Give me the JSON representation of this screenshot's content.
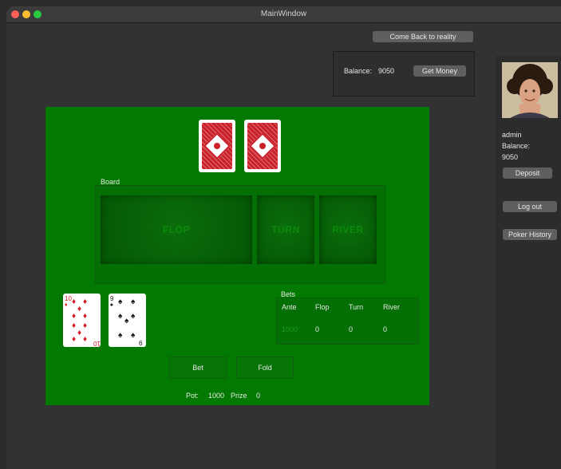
{
  "window": {
    "title": "MainWindow"
  },
  "header": {
    "back_button": "Come Back to reality"
  },
  "balance_box": {
    "label": "Balance:",
    "value": "9050",
    "get_money_button": "Get Money"
  },
  "sidebar": {
    "username": "admin",
    "balance_label": "Balance:",
    "balance_value": "9050",
    "deposit_button": "Deposit",
    "logout_button": "Log out",
    "history_button": "Poker History"
  },
  "table": {
    "board_title": "Board",
    "flop_label": "FLOP",
    "turn_label": "TURN",
    "river_label": "RIVER",
    "player_cards": [
      {
        "rank": "10",
        "suit": "♦"
      },
      {
        "rank": "9",
        "suit": "♠"
      }
    ],
    "bets": {
      "title": "Bets",
      "headers": [
        "Ante",
        "Flop",
        "Turn",
        "River"
      ],
      "values": [
        "1000",
        "0",
        "0",
        "0"
      ]
    },
    "bet_button": "Bet",
    "fold_button": "Fold",
    "pot_label": "Pot:",
    "pot_value": "1000",
    "prize_label": "Prize",
    "prize_value": "0"
  },
  "colors": {
    "felt": "#027a02",
    "card_back": "#c9202a",
    "window": "#323232"
  }
}
